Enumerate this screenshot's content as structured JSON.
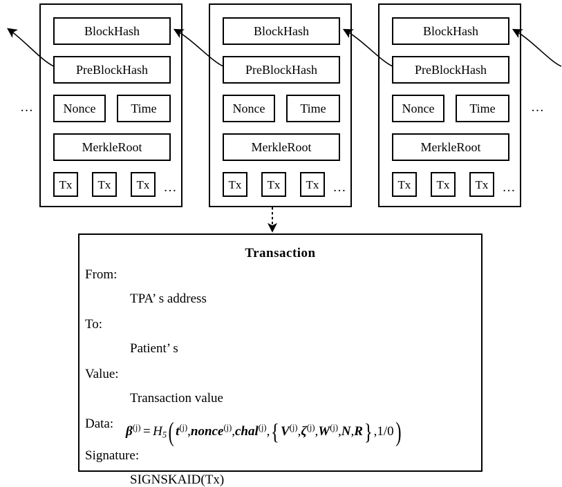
{
  "diagram": {
    "type": "blockchain-transaction-structure",
    "background_color": "#ffffff",
    "line_color": "#000000"
  },
  "chain": {
    "left_ellipsis": "…",
    "right_ellipsis": "…",
    "blocks": [
      {
        "id": "block-1",
        "block_hash": "BlockHash",
        "pre_block_hash": "PreBlockHash",
        "nonce": "Nonce",
        "time": "Time",
        "merkle_root": "MerkleRoot",
        "transactions": [
          "Tx",
          "Tx",
          "Tx"
        ],
        "tx_ellipsis": "…"
      },
      {
        "id": "block-2",
        "block_hash": "BlockHash",
        "pre_block_hash": "PreBlockHash",
        "nonce": "Nonce",
        "time": "Time",
        "merkle_root": "MerkleRoot",
        "transactions": [
          "Tx",
          "Tx",
          "Tx"
        ],
        "tx_ellipsis": "…"
      },
      {
        "id": "block-3",
        "block_hash": "BlockHash",
        "pre_block_hash": "PreBlockHash",
        "nonce": "Nonce",
        "time": "Time",
        "merkle_root": "MerkleRoot",
        "transactions": [
          "Tx",
          "Tx",
          "Tx"
        ],
        "tx_ellipsis": "…"
      }
    ]
  },
  "transaction": {
    "title": "Transaction",
    "fields": [
      {
        "label": "From:",
        "value": "TPA’  s address"
      },
      {
        "label": "To:",
        "value": "Patient’  s"
      },
      {
        "label": "Value:",
        "value": "Transaction value"
      },
      {
        "label": "Data:",
        "value": ""
      },
      {
        "label": "Signature:",
        "value": "SIGNSKAID(Tx)"
      }
    ],
    "data_formula_text": "β(j) = H5( t(j), nonce(j), chal(j), { V(j), ζ(j), W(j), N, R }, 1/0 )",
    "data_formula_parts": {
      "lhs": "β",
      "lhs_sup": "(j)",
      "equals": "=",
      "hash_fn": "H",
      "hash_sub": "5",
      "arg1": "t",
      "arg1_sup": "(j)",
      "arg2": "nonce",
      "arg2_sup": "(j)",
      "arg3": "chal",
      "arg3_sup": "(j)",
      "set1": "V",
      "set1_sup": "(j)",
      "set2": "ζ",
      "set2_sup": "(j)",
      "set3": "W",
      "set3_sup": "(j)",
      "set4": "N",
      "set5": "R",
      "flag": "1/0"
    }
  }
}
